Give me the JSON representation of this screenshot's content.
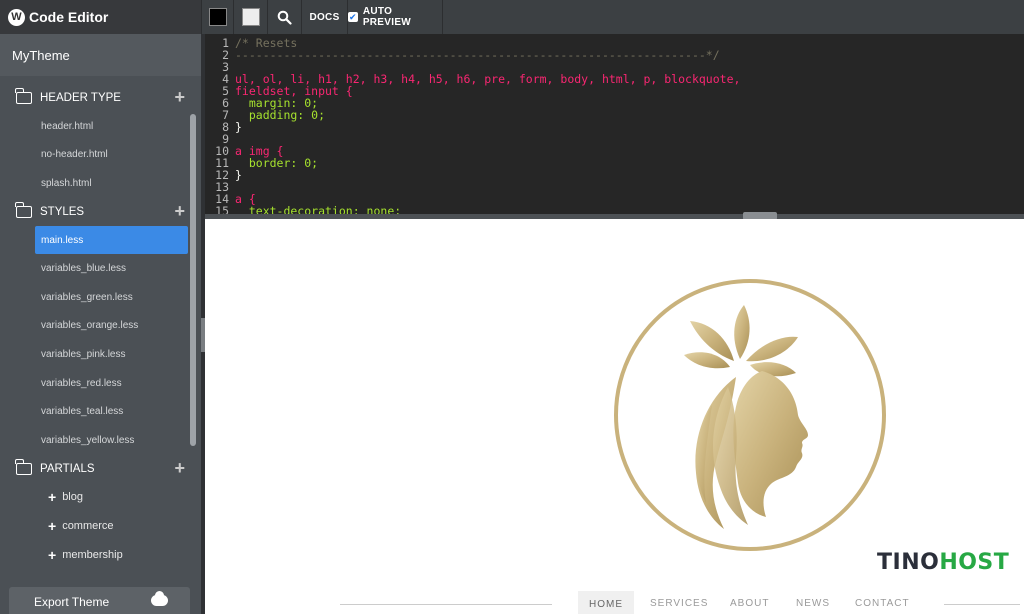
{
  "app": {
    "title": "Code Editor",
    "logo_letter": "W"
  },
  "toolbar": {
    "color_dark": "#000000",
    "color_light": "#eeeeee",
    "search_icon": "search-icon",
    "docs_label": "DOCS",
    "auto_preview_label": "AUTO PREVIEW",
    "auto_preview_checked": true
  },
  "sidebar": {
    "project_name": "MyTheme",
    "sections": {
      "header_type": {
        "label": "HEADER TYPE",
        "files": [
          "header.html",
          "no-header.html",
          "splash.html"
        ]
      },
      "styles": {
        "label": "STYLES",
        "files": [
          "main.less",
          "variables_blue.less",
          "variables_green.less",
          "variables_orange.less",
          "variables_pink.less",
          "variables_red.less",
          "variables_teal.less",
          "variables_yellow.less"
        ],
        "active": "main.less"
      },
      "partials": {
        "label": "PARTIALS",
        "items": [
          "blog",
          "commerce",
          "membership"
        ]
      }
    },
    "export_label": "Export Theme"
  },
  "editor": {
    "lines": [
      {
        "n": "1",
        "text": "/* Resets"
      },
      {
        "n": "2",
        "text": "--------------------------------------------------------------------*/"
      },
      {
        "n": "3",
        "text": ""
      },
      {
        "n": "4",
        "text": "ul, ol, li, h1, h2, h3, h4, h5, h6, pre, form, body, html, p, blockquote,"
      },
      {
        "n": "5",
        "text": "fieldset, input {"
      },
      {
        "n": "6",
        "text": "  margin: 0;"
      },
      {
        "n": "7",
        "text": "  padding: 0;"
      },
      {
        "n": "8",
        "text": "}"
      },
      {
        "n": "9",
        "text": ""
      },
      {
        "n": "10",
        "text": "a img {"
      },
      {
        "n": "11",
        "text": "  border: 0;"
      },
      {
        "n": "12",
        "text": "}"
      },
      {
        "n": "13",
        "text": ""
      },
      {
        "n": "14",
        "text": "a {"
      },
      {
        "n": "15",
        "text": "  text-decoration: none;"
      }
    ]
  },
  "preview": {
    "watermark_part1": "TINO",
    "watermark_part2": "HOST",
    "nav": [
      "HOME",
      "SERVICES",
      "ABOUT",
      "NEWS",
      "CONTACT"
    ],
    "brand_color": "#c9b27c"
  }
}
